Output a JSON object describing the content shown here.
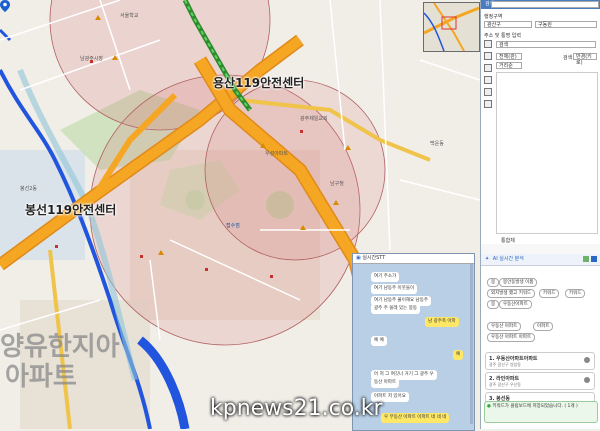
{
  "map": {
    "stations": [
      "용산119안전센터",
      "봉선119안전센터"
    ],
    "big_text_1": "양유한지아",
    "big_text_2": "아파트",
    "pin_label": "접수점"
  },
  "colors": {
    "road_major": "#f5a623",
    "road_edge": "#e08a1a",
    "rail": "#3aa53a",
    "river": "#2255dd",
    "buffer_fill": "rgba(214,120,120,0.25)",
    "buffer_stroke": "#b06060",
    "panel_header": "#4a7bc0",
    "chat_bg": "#b9cfe6",
    "bubble_mine": "#ffe866"
  },
  "panel": {
    "header": "검색",
    "region_label": "행정구역",
    "region_value_1": "광산구",
    "region_value_2": "구동원",
    "search_placeholder": "주소 및 통명 입력",
    "tab": "검색",
    "filter_1": "전체(관)",
    "filter_2": "거리순",
    "sort_label": "검색",
    "sort_value": "반경(키로)",
    "footer": "통합체"
  },
  "ai": {
    "title": "AI 실시간 분석",
    "chips_row1": [
      "봉",
      "봉안동발생 이품"
    ],
    "chips_row2": [
      "외지발생 했고 키워드",
      "키워드",
      "키워드"
    ],
    "chips_row3": [
      "봉",
      "우동산아파트"
    ],
    "chips_row4": [
      "우동산 아파트",
      "아파트"
    ],
    "chips_row5": [
      "우동산 아파트 아파트"
    ],
    "results": [
      {
        "title": "1. 우동산아파트아파트",
        "sub": "광주 광산구 쌍암동"
      },
      {
        "title": "2. 라인아파트",
        "sub": "광주 광산구 우산동"
      },
      {
        "title": "3. 봉선동",
        "sub": "광주 남구 봉선동"
      }
    ],
    "toast": "키워드가 클립보드에 저장되었습니다. ( 1개 )"
  },
  "stt": {
    "title": "실시간STT",
    "messages": [
      {
        "side": "l",
        "text": "여기 주소가"
      },
      {
        "side": "l",
        "text": "여기 남동주 이웃들이"
      },
      {
        "side": "l",
        "text": "여기 남동주 불이해요 남동주"
      },
      {
        "side": "l",
        "text": "광주 주 쓸레 있는 봉동"
      },
      {
        "side": "r",
        "text": "남 광주축 아파"
      },
      {
        "side": "l",
        "text": "예 예"
      },
      {
        "side": "r",
        "text": "예"
      },
      {
        "side": "l",
        "text": "어 저 그 여깃나 거기 그 광주 우"
      },
      {
        "side": "l",
        "text": "동산 아파트"
      },
      {
        "side": "l",
        "text": "아파트 저 있어요"
      },
      {
        "side": "r",
        "text": "우 무동산 아파트 아파트 네 네 네"
      }
    ]
  },
  "watermark": "kрnews21.co.kr"
}
